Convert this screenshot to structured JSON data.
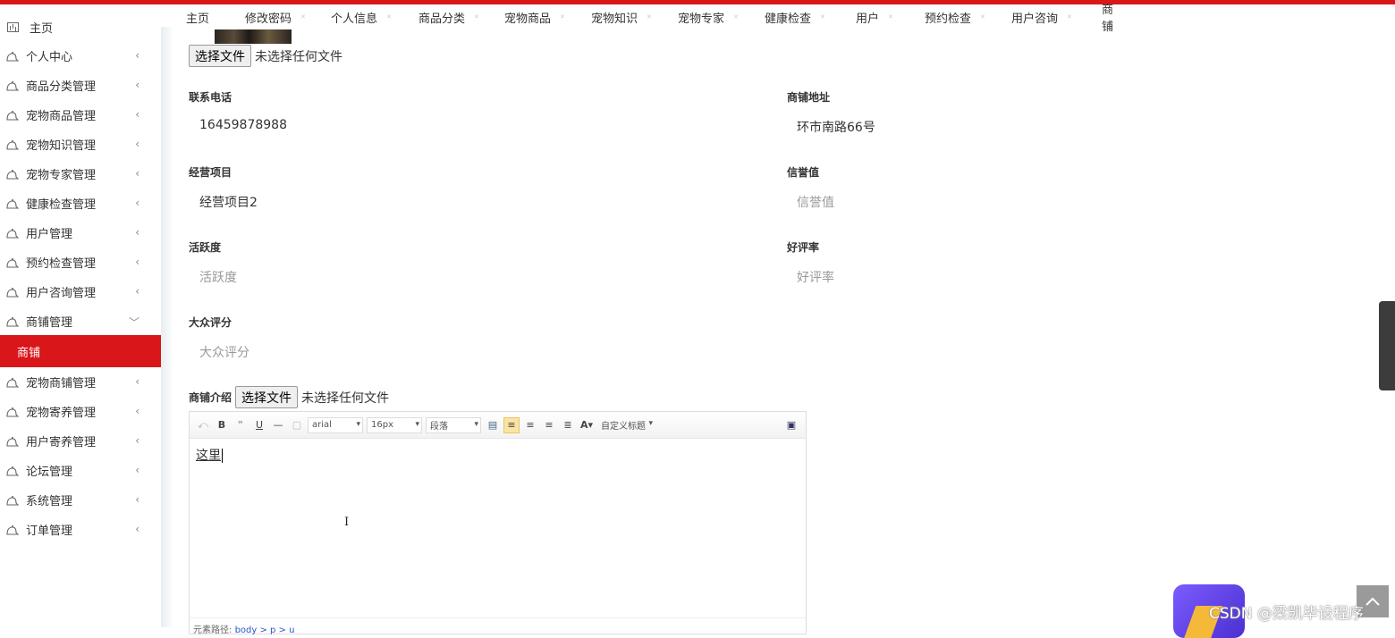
{
  "nav": [
    "主页",
    "修改密码",
    "个人信息",
    "商品分类",
    "宠物商品",
    "宠物知识",
    "宠物专家",
    "健康检查",
    "用户",
    "预约检查",
    "用户咨询",
    "商铺"
  ],
  "sidebar": {
    "home": "主页",
    "items": [
      "个人中心",
      "商品分类管理",
      "宠物商品管理",
      "宠物知识管理",
      "宠物专家管理",
      "健康检查管理",
      "用户管理",
      "预约检查管理",
      "用户咨询管理",
      "商铺管理"
    ],
    "active": "商铺",
    "items_after": [
      "宠物商铺管理",
      "宠物寄养管理",
      "用户寄养管理",
      "论坛管理",
      "系统管理",
      "订单管理"
    ]
  },
  "form": {
    "file_button": "选择文件",
    "file_none": "未选择任何文件",
    "phone_label": "联系电话",
    "phone_value": "16459878988",
    "address_label": "商铺地址",
    "address_value": "环市南路66号",
    "business_label": "经营项目",
    "business_value": "经营项目2",
    "credit_label": "信誉值",
    "credit_placeholder": "信誉值",
    "activity_label": "活跃度",
    "activity_placeholder": "活跃度",
    "rating_label": "好评率",
    "rating_placeholder": "好评率",
    "score_label": "大众评分",
    "score_placeholder": "大众评分",
    "intro_label": "商铺介绍"
  },
  "editor": {
    "font": "arial",
    "size": "16px",
    "paragraph": "段落",
    "custom_title": "自定义标题",
    "content": "这里",
    "footer_label": "元素路径",
    "footer_path": "body > p > u"
  },
  "watermark": "CSDN @梁凯毕设程序",
  "colors": {
    "accent": "#d9161a"
  }
}
